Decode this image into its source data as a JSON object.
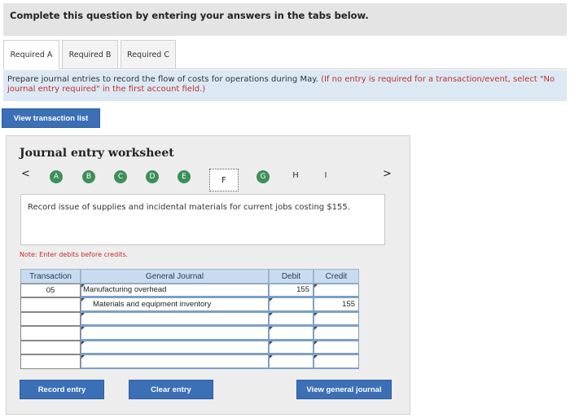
{
  "header": {
    "text": "Complete this question by entering your answers in the tabs below."
  },
  "tabs": [
    {
      "label": "Required A",
      "active": true
    },
    {
      "label": "Required B",
      "active": false
    },
    {
      "label": "Required C",
      "active": false
    }
  ],
  "instructions": {
    "main": "Prepare journal entries to record the flow of costs for operations during May.",
    "note": "(If no entry is required for a transaction/event, select \"No journal entry required\" in the first account field.)"
  },
  "buttons": {
    "view_transaction_list": "View transaction list",
    "record_entry": "Record entry",
    "clear_entry": "Clear entry",
    "view_general_journal": "View general journal"
  },
  "worksheet": {
    "title": "Journal entry worksheet",
    "prev_icon": "chevron-left-icon",
    "next_icon": "chevron-right-icon",
    "prev_glyph": "<",
    "next_glyph": ">",
    "steps": [
      {
        "label": "A",
        "done": true
      },
      {
        "label": "B",
        "done": true
      },
      {
        "label": "C",
        "done": true
      },
      {
        "label": "D",
        "done": true
      },
      {
        "label": "E",
        "done": true
      },
      {
        "label": "F",
        "done": false,
        "selected": true
      },
      {
        "label": "G",
        "done": true
      },
      {
        "label": "H",
        "done": false
      },
      {
        "label": "I",
        "done": false
      }
    ],
    "description": "Record issue of supplies and incidental materials for current jobs costing $155.",
    "note": "Note: Enter debits before credits."
  },
  "table": {
    "headers": {
      "transaction": "Transaction",
      "general_journal": "General Journal",
      "debit": "Debit",
      "credit": "Credit"
    },
    "rows": [
      {
        "transaction": "05",
        "account": "Manufacturing overhead",
        "debit": "155",
        "credit": ""
      },
      {
        "transaction": "",
        "account": "Materials and equipment inventory",
        "debit": "",
        "credit": "155"
      },
      {
        "transaction": "",
        "account": "",
        "debit": "",
        "credit": ""
      },
      {
        "transaction": "",
        "account": "",
        "debit": "",
        "credit": ""
      },
      {
        "transaction": "",
        "account": "",
        "debit": "",
        "credit": ""
      },
      {
        "transaction": "",
        "account": "",
        "debit": "",
        "credit": ""
      }
    ]
  },
  "colors": {
    "accent": "#3b6fb6",
    "step_done": "#3e8f57",
    "warning": "#c0312b",
    "header_bg": "#c9dcef"
  }
}
